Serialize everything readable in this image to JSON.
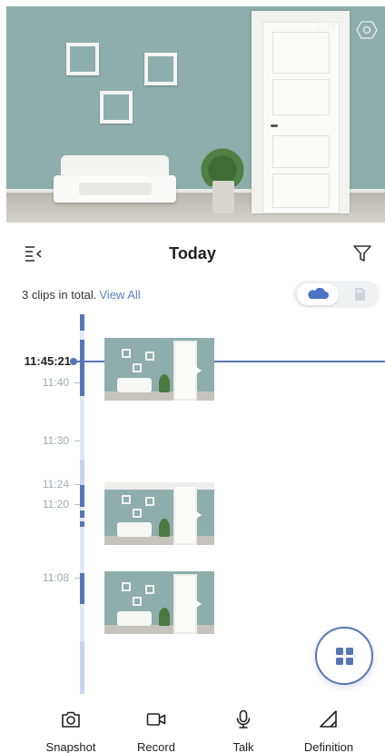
{
  "preview": {
    "overlay_icons": [
      "external-open-icon",
      "settings-hexagon-icon"
    ]
  },
  "header": {
    "title": "Today",
    "left_icon": "collapse-list-icon",
    "right_icon": "filter-icon"
  },
  "summary": {
    "count_text": "3 clips in total.",
    "view_all_label": "View All"
  },
  "storage_toggle": {
    "options": [
      "cloud-icon",
      "sd-card-icon"
    ],
    "selected": "cloud-icon",
    "accent_color": "#4d72c2"
  },
  "timeline": {
    "current_time": "11:45:21",
    "labels": [
      "11:40",
      "11:30",
      "11:24",
      "11:20",
      "11:08"
    ],
    "track_color": "#c9d5ef",
    "segment_color": "#5876b6"
  },
  "clips": [
    {
      "thumbnail": "clip-thumbnail"
    },
    {
      "thumbnail": "clip-thumbnail"
    },
    {
      "thumbnail": "clip-thumbnail"
    }
  ],
  "fab": {
    "icon": "grid-menu-icon"
  },
  "toolbar": {
    "items": [
      {
        "label": "Snapshot",
        "icon": "camera-icon"
      },
      {
        "label": "Record",
        "icon": "video-camera-icon"
      },
      {
        "label": "Talk",
        "icon": "microphone-icon"
      },
      {
        "label": "Definition",
        "icon": "definition-triangle-icon"
      }
    ]
  }
}
